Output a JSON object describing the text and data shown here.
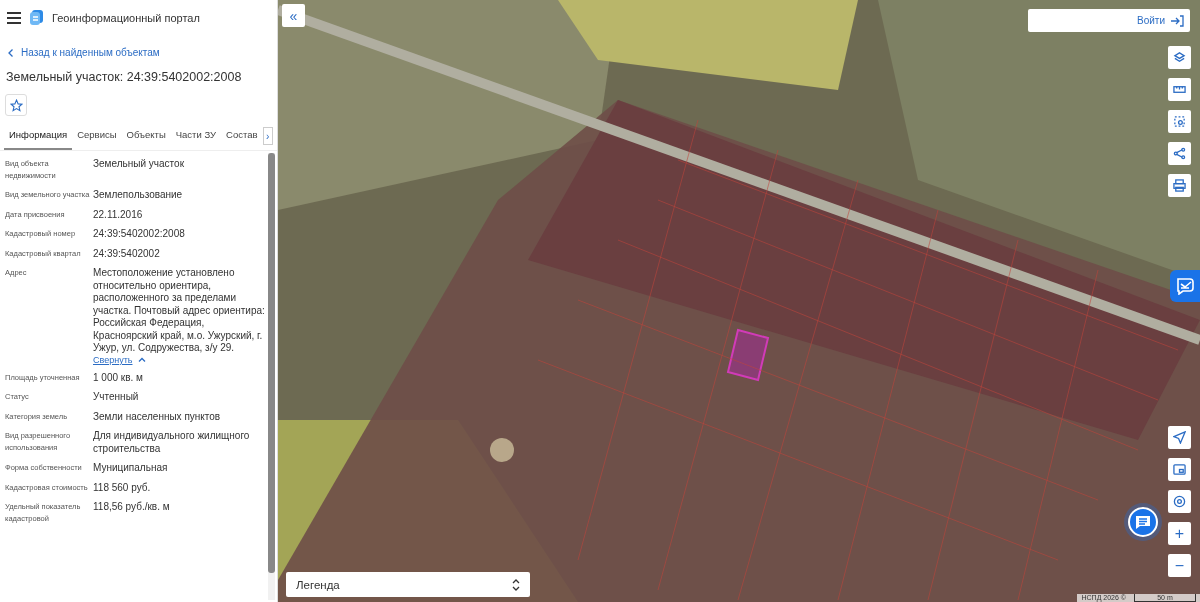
{
  "header": {
    "title": "Геоинформационный портал"
  },
  "back_link": "Назад к найденным объектам",
  "object_title": "Земельный участок: 24:39:5402002:2008",
  "favorite": {
    "selected": false
  },
  "tabs": [
    {
      "label": "Информация",
      "selected": true
    },
    {
      "label": "Сервисы",
      "selected": false
    },
    {
      "label": "Объекты",
      "selected": false
    },
    {
      "label": "Части ЗУ",
      "selected": false
    },
    {
      "label": "Состав",
      "selected": false
    }
  ],
  "tabs_next": "›",
  "properties": [
    {
      "label": "Вид объекта недвижимости",
      "value": "Земельный участок"
    },
    {
      "label": "Вид земельного участка",
      "value": "Землепользование"
    },
    {
      "label": "Дата присвоения",
      "value": "22.11.2016"
    },
    {
      "label": "Кадастровый номер",
      "value": "24:39:5402002:2008"
    },
    {
      "label": "Кадастровый квартал",
      "value": "24:39:5402002"
    },
    {
      "label": "Адрес",
      "value": "Местоположение установлено относительно ориентира, расположенного за пределами участка. Почтовый адрес ориентира: Российская Федерация, Красноярский край, м.о. Ужурский, г. Ужур, ул. Содружества, з/у 29.",
      "toggle": "Свернуть"
    },
    {
      "label": "Площадь уточненная",
      "value": "1 000 кв. м"
    },
    {
      "label": "Статус",
      "value": "Учтенный"
    },
    {
      "label": "Категория земель",
      "value": "Земли населенных пунктов"
    },
    {
      "label": "Вид разрешенного использования",
      "value": "Для индивидуального жилищного строительства"
    },
    {
      "label": "Форма собственности",
      "value": "Муниципальная"
    },
    {
      "label": "Кадастровая стоимость",
      "value": "118 560 руб."
    },
    {
      "label": "Удельный показатель кадастровой",
      "value": "118,56 руб./кв. м"
    }
  ],
  "map": {
    "collapse": "«",
    "login": "Войти",
    "legend": "Легенда",
    "attribution": "НСПД 2026 ©",
    "scale": "50 m",
    "zoom_in": "+",
    "zoom_out": "−"
  }
}
